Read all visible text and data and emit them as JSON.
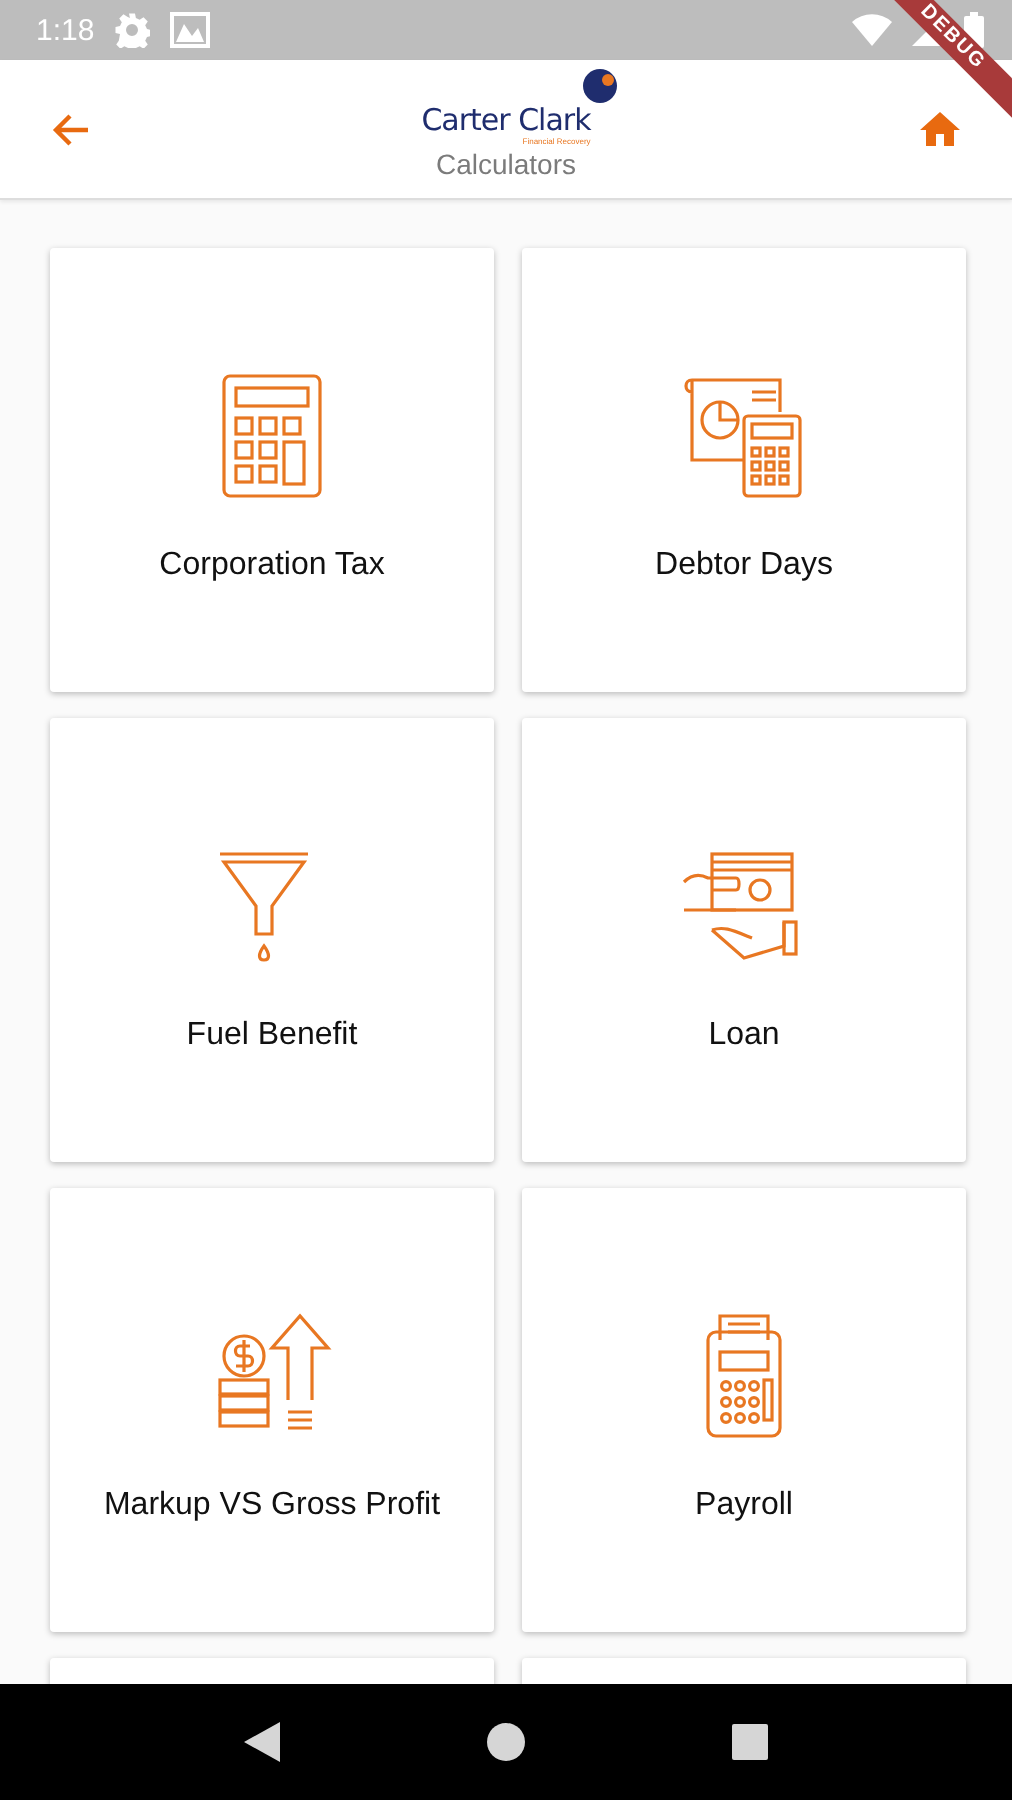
{
  "status_bar": {
    "time": "1:18"
  },
  "debug_banner": {
    "label": "DEBUG"
  },
  "app_bar": {
    "logo": {
      "name": "Carter Clark",
      "tagline": "Financial Recovery"
    },
    "title": "Calculators"
  },
  "cards": [
    {
      "kind": "calculator",
      "label": "Corporation Tax"
    },
    {
      "kind": "report",
      "label": "Debtor Days"
    },
    {
      "kind": "funnel",
      "label": "Fuel Benefit"
    },
    {
      "kind": "cash",
      "label": "Loan"
    },
    {
      "kind": "growth",
      "label": "Markup VS Gross Profit"
    },
    {
      "kind": "till",
      "label": "Payroll"
    },
    {
      "kind": "partial"
    },
    {
      "kind": "partial"
    }
  ]
}
